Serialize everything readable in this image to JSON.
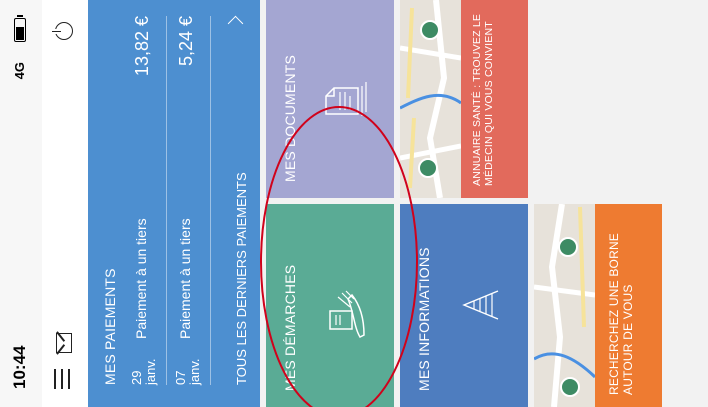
{
  "status_bar": {
    "time": "10:44",
    "carrier": "4G"
  },
  "app_bar": {
    "menu_icon": "menu-icon",
    "mail_icon": "mail-icon",
    "power_icon": "power-icon"
  },
  "payments": {
    "title": "MES PAIEMENTS",
    "rows": [
      {
        "day": "29",
        "month": "janv.",
        "label": "Paiement à un tiers",
        "amount": "13,82 €"
      },
      {
        "day": "07",
        "month": "janv.",
        "label": "Paiement à un tiers",
        "amount": "5,24 €"
      }
    ],
    "all_link": "TOUS LES DERNIERS PAIEMENTS"
  },
  "tiles": {
    "demarches": "MES DÉMARCHES",
    "documents": "MES DOCUMENTS",
    "informations": "MES INFORMATIONS",
    "annuaire": "ANNUAIRE SANTÉ : TROUVEZ LE MÉDECIN QUI VOUS CONVIENT",
    "borne": "RECHERCHEZ UNE BORNE AUTOUR DE VOUS"
  },
  "colors": {
    "payments": "#4d8fd0",
    "demarches": "#5aab95",
    "documents": "#a4a6d2",
    "informations": "#4e7dbf",
    "annuaire": "#e26a5c",
    "borne": "#ee7b31",
    "annotation": "#d0021b"
  }
}
